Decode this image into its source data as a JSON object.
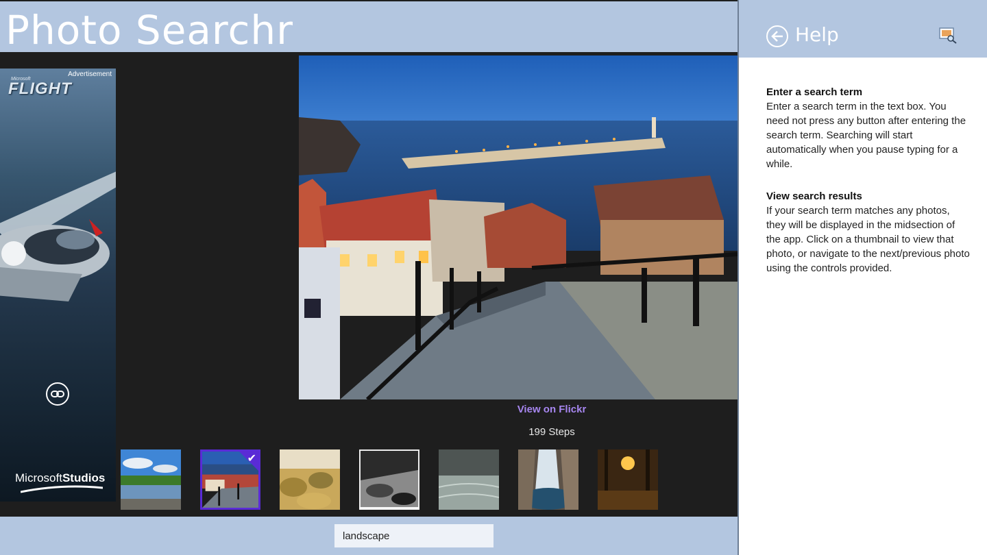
{
  "app": {
    "title": "Photo Searchr"
  },
  "ad": {
    "label": "Advertisement",
    "brand_small": "Microsoft",
    "brand": "FLIGHT",
    "studio_prefix": "Microsoft",
    "studio_suffix": "Studios",
    "link_icon": "link-icon"
  },
  "photo": {
    "view_link": "View on Flickr",
    "title": "199 Steps"
  },
  "thumbnails": [
    {
      "name": "lake-landscape"
    },
    {
      "name": "199-steps",
      "selected": true
    },
    {
      "name": "desert-shrubs"
    },
    {
      "name": "black-white-rocks"
    },
    {
      "name": "misty-water"
    },
    {
      "name": "waterfall-canyon"
    },
    {
      "name": "forest-sunset"
    }
  ],
  "search": {
    "value": "landscape"
  },
  "help": {
    "title": "Help",
    "back_icon": "back-arrow-icon",
    "corner_icon": "image-search-icon",
    "sections": [
      {
        "heading": "Enter a search term",
        "text": "Enter a search term in the text box. You need not press any button after entering the search term. Searching will start automatically when you pause typing for a while."
      },
      {
        "heading": "View search results",
        "text": "If your search term matches any photos, they will be displayed in the midsection of the app. Click on a thumbnail to view that photo, or navigate to the next/previous photo using the controls provided."
      }
    ]
  },
  "colors": {
    "bar": "#b3c6e0",
    "accent": "#5a2bd6",
    "link": "#a786f0",
    "background": "#1e1e1e"
  }
}
